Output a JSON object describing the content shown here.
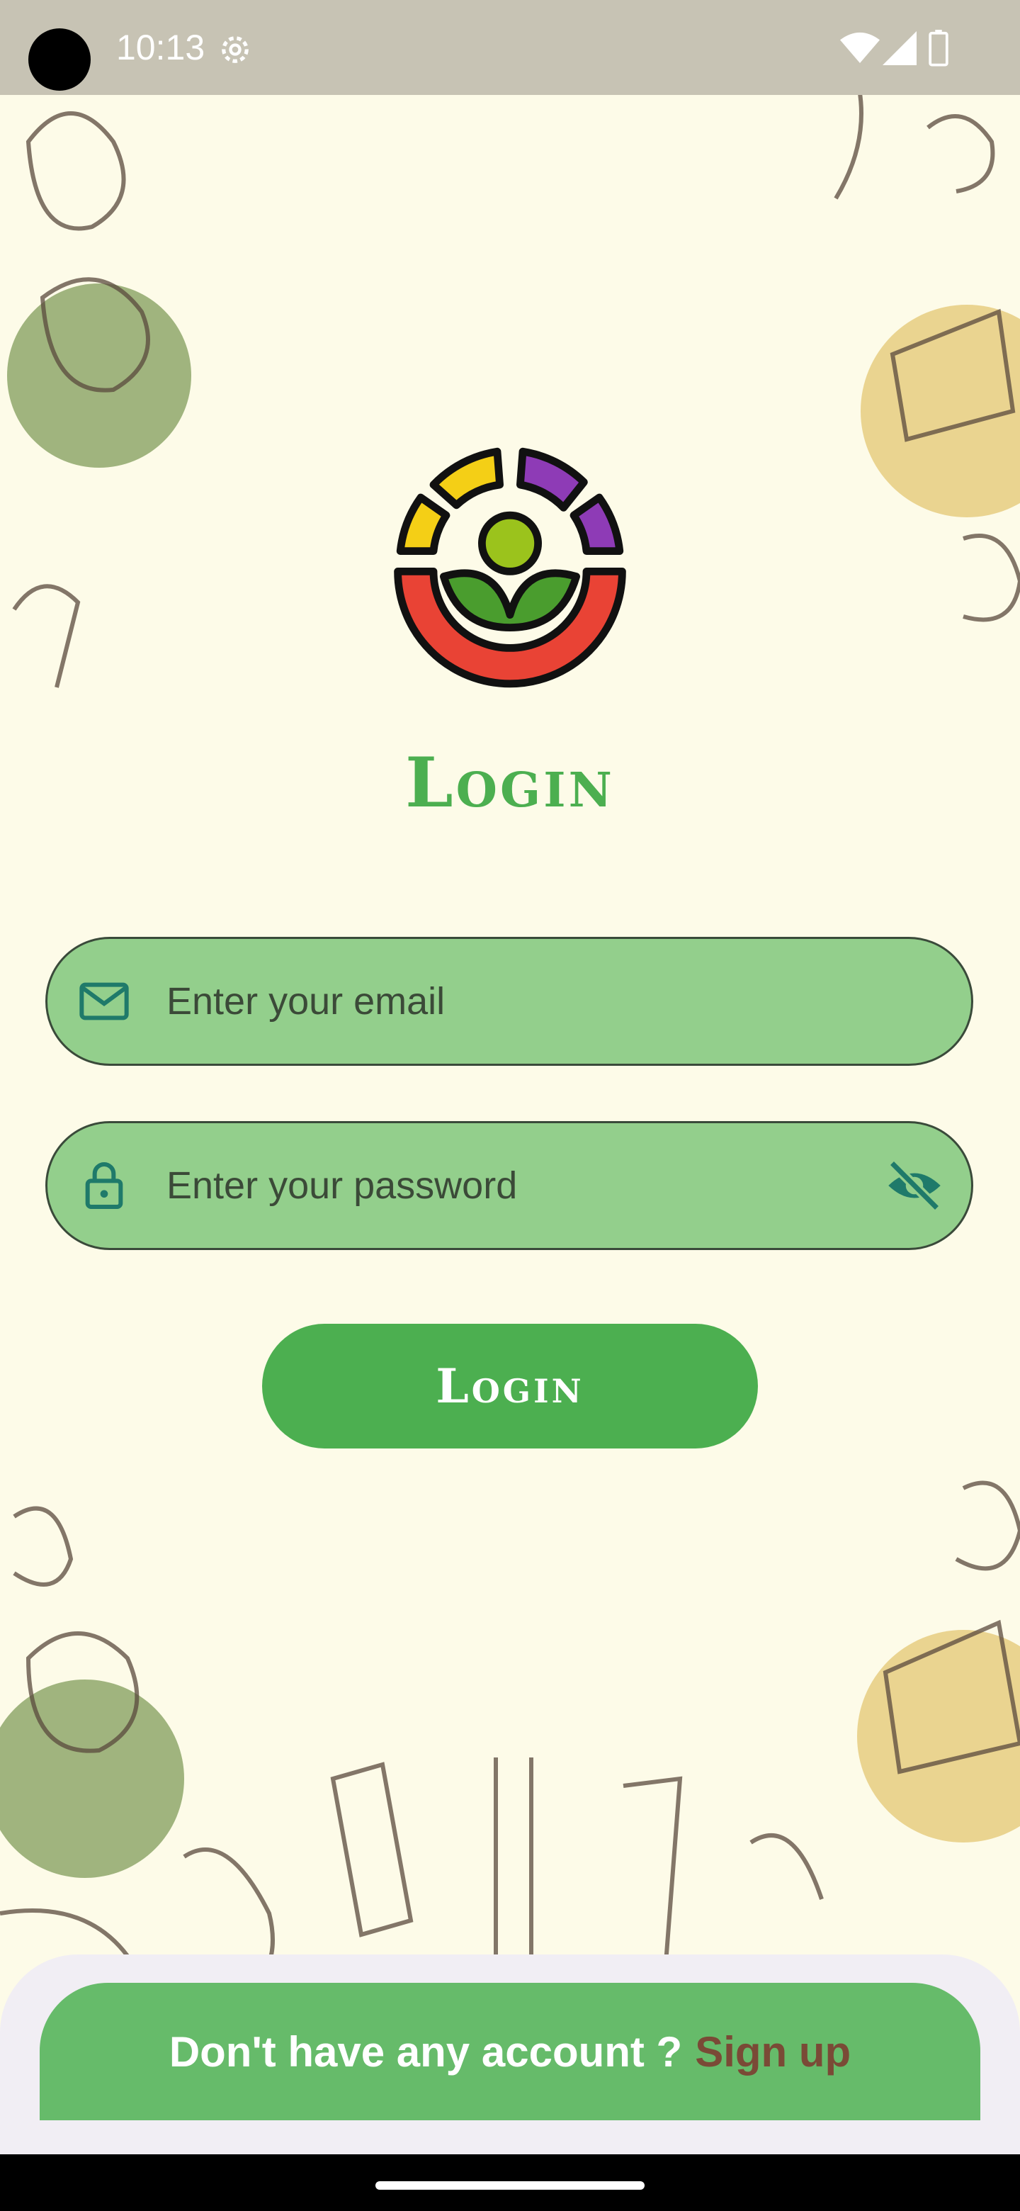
{
  "status_bar": {
    "time": "10:13",
    "icons": [
      "settings-icon",
      "wifi-icon",
      "signal-icon",
      "battery-icon"
    ]
  },
  "app": {
    "logo": "app-logo",
    "title": "Login"
  },
  "form": {
    "email": {
      "placeholder": "Enter your email",
      "icon": "mail-icon"
    },
    "password": {
      "placeholder": "Enter your password",
      "icon": "lock-icon",
      "toggle_icon": "eye-off-icon"
    },
    "submit_label": "Login"
  },
  "footer": {
    "prompt": "Don't have any account ?",
    "link": "Sign up"
  },
  "colors": {
    "background": "#fdfbe8",
    "accent_green": "#4caf50",
    "field_fill": "#93cf8c",
    "footer_green": "#66bb6a",
    "link_brown": "#7a4a36"
  }
}
